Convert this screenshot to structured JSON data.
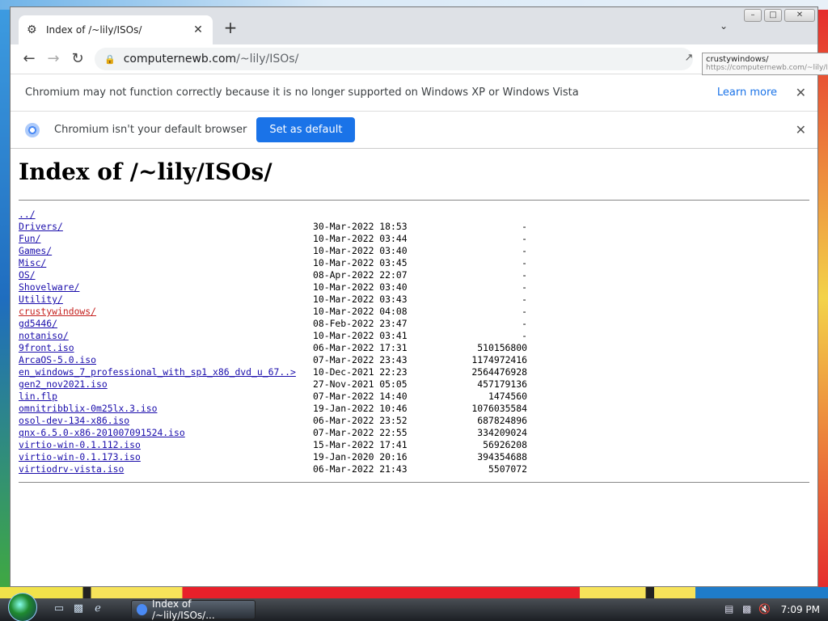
{
  "tab": {
    "title": "Index of /~lily/ISOs/",
    "favicon": "page-icon"
  },
  "toolbar": {
    "url_host": "computernewb.com",
    "url_path": "/~lily/ISOs/"
  },
  "tooltip": {
    "title": "crustywindows/",
    "url": "https://computernewb.com/~lily/ISOs/"
  },
  "infobar1": {
    "message": "Chromium may not function correctly because it is no longer supported on Windows XP or Windows Vista",
    "link": "Learn more"
  },
  "infobar2": {
    "message": "Chromium isn't your default browser",
    "button": "Set as default"
  },
  "page": {
    "heading": "Index of /~lily/ISOs/",
    "parent": "../",
    "entries": [
      {
        "name": "Drivers/",
        "date": "30-Mar-2022 18:53",
        "size": "-"
      },
      {
        "name": "Fun/",
        "date": "10-Mar-2022 03:44",
        "size": "-"
      },
      {
        "name": "Games/",
        "date": "10-Mar-2022 03:40",
        "size": "-"
      },
      {
        "name": "Misc/",
        "date": "10-Mar-2022 03:45",
        "size": "-"
      },
      {
        "name": "OS/",
        "date": "08-Apr-2022 22:07",
        "size": "-"
      },
      {
        "name": "Shovelware/",
        "date": "10-Mar-2022 03:40",
        "size": "-"
      },
      {
        "name": "Utility/",
        "date": "10-Mar-2022 03:43",
        "size": "-"
      },
      {
        "name": "crustywindows/",
        "date": "10-Mar-2022 04:08",
        "size": "-",
        "visited": true
      },
      {
        "name": "gd5446/",
        "date": "08-Feb-2022 23:47",
        "size": "-"
      },
      {
        "name": "notaniso/",
        "date": "10-Mar-2022 03:41",
        "size": "-"
      },
      {
        "name": "9front.iso",
        "date": "06-Mar-2022 17:31",
        "size": "510156800"
      },
      {
        "name": "ArcaOS-5.0.iso",
        "date": "07-Mar-2022 23:43",
        "size": "1174972416"
      },
      {
        "name": "en_windows_7_professional_with_sp1_x86_dvd_u_67..>",
        "date": "10-Dec-2021 22:23",
        "size": "2564476928"
      },
      {
        "name": "gen2_nov2021.iso",
        "date": "27-Nov-2021 05:05",
        "size": "457179136"
      },
      {
        "name": "lin.flp",
        "date": "07-Mar-2022 14:40",
        "size": "1474560"
      },
      {
        "name": "omnitribblix-0m25lx.3.iso",
        "date": "19-Jan-2022 10:46",
        "size": "1076035584"
      },
      {
        "name": "osol-dev-134-x86.iso",
        "date": "06-Mar-2022 23:52",
        "size": "687824896"
      },
      {
        "name": "qnx-6.5.0-x86-201007091524.iso",
        "date": "07-Mar-2022 22:55",
        "size": "334209024"
      },
      {
        "name": "virtio-win-0.1.112.iso",
        "date": "15-Mar-2022 17:41",
        "size": "56926208"
      },
      {
        "name": "virtio-win-0.1.173.iso",
        "date": "19-Jan-2020 20:16",
        "size": "394354688"
      },
      {
        "name": "virtiodrv-vista.iso",
        "date": "06-Mar-2022 21:43",
        "size": "5507072"
      }
    ]
  },
  "taskbar": {
    "task_title": "Index of /~lily/ISOs/...",
    "clock": "7:09 PM"
  }
}
